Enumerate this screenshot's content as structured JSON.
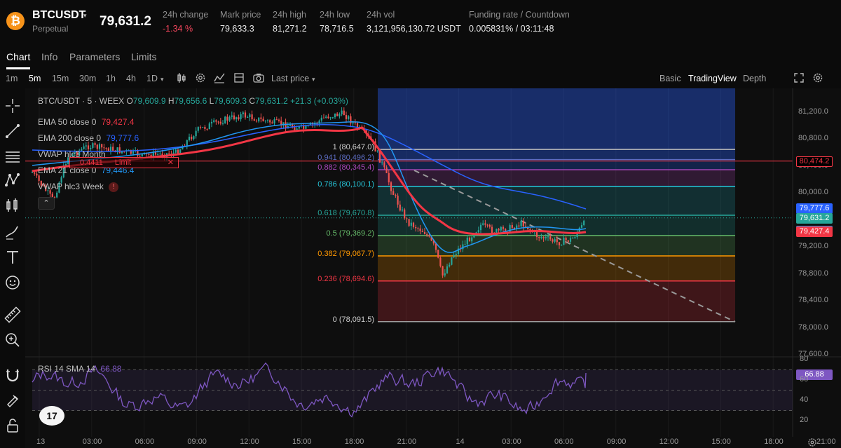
{
  "header": {
    "logo_glyph": "₿",
    "symbol": "BTCUSDT",
    "caret": "▾",
    "contract_type": "Perpetual",
    "last_price": "79,631.2",
    "stats": [
      {
        "label": "24h change",
        "value": "-1.34 %",
        "negative": true
      },
      {
        "label": "Mark price",
        "value": "79,633.3"
      },
      {
        "label": "24h high",
        "value": "81,271.2"
      },
      {
        "label": "24h low",
        "value": "78,716.5"
      },
      {
        "label": "24h vol",
        "value": "3,121,956,130.72 USDT"
      },
      {
        "label": "Funding rate / Countdown",
        "value": "0.005831% / 03:11:48"
      }
    ]
  },
  "tabs": [
    "Chart",
    "Info",
    "Parameters",
    "Limits"
  ],
  "toolbar": {
    "intervals": [
      "1m",
      "5m",
      "15m",
      "30m",
      "1h",
      "4h",
      "1D"
    ],
    "active_interval": "5m",
    "interval_dropdown": "▾",
    "price_source": "Last price",
    "price_source_caret": "▾",
    "views": [
      "Basic",
      "TradingView",
      "Depth"
    ],
    "active_view": "TradingView"
  },
  "chart": {
    "ohlc": {
      "title": "BTC/USDT · 5 · WEEX",
      "o_label": "O",
      "o_value": "79,609.9",
      "h_label": "H",
      "h_value": "79,656.6",
      "l_label": "L",
      "l_value": "79,609.3",
      "c_label": "C",
      "c_value": "79,631.2",
      "change": "+21.3 (+0.03%)"
    },
    "indicators": [
      {
        "label": "EMA 50 close 0",
        "value": "79,427.4",
        "color": "#f23645"
      },
      {
        "label": "EMA 200 close 0",
        "value": "79,777.6",
        "color": "#2962ff"
      },
      {
        "label": "VWAP hlc3 Month",
        "value": "",
        "color": "#bdbdbd"
      },
      {
        "label": "EMA 21 close 0",
        "value": "79,446.4",
        "color": "#2196f3"
      },
      {
        "label": "VWAP hlc3 Week",
        "value": "",
        "color": "#bdbdbd"
      }
    ],
    "warning_glyph": "!",
    "collapse_glyph": "⌃",
    "limit_order": {
      "qty": "0.4411",
      "label": "Limit",
      "close": "✕"
    },
    "fib_levels": [
      {
        "label": "1 (80,647.0)",
        "price": 80647.0,
        "color": "#bdbdbd"
      },
      {
        "label": "0.941 (80,496.2)",
        "price": 80496.2,
        "color": "#5c6bc0"
      },
      {
        "label": "0.882 (80,345.4)",
        "price": 80345.4,
        "color": "#ab47bc"
      },
      {
        "label": "0.786 (80,100.1)",
        "price": 80100.1,
        "color": "#26c6da"
      },
      {
        "label": "0.618 (79,670.8)",
        "price": 79670.8,
        "color": "#26a69a"
      },
      {
        "label": "0.5 (79,369.2)",
        "price": 79369.2,
        "color": "#66bb6a"
      },
      {
        "label": "0.382 (79,067.7)",
        "price": 79067.7,
        "color": "#ff9800"
      },
      {
        "label": "0.236 (78,694.6)",
        "price": 78694.6,
        "color": "#f23645"
      },
      {
        "label": "0 (78,091.5)",
        "price": 78091.5,
        "color": "#9e9e9e"
      }
    ],
    "price_axis": [
      "81,200.0",
      "80,800.0",
      "80,400.0",
      "80,000.0",
      "79,600.0",
      "79,200.0",
      "78,800.0",
      "78,400.0",
      "78,000.0",
      "77,600.0"
    ],
    "price_tags": [
      {
        "text": "80,474.2",
        "color": "#000000",
        "border": "#f23645",
        "price": 80474.2
      },
      {
        "text": "79,777.6",
        "color": "#2962ff",
        "price": 79777.6
      },
      {
        "text": "79,631.2",
        "color": "#26a69a",
        "price": 79631.2
      },
      {
        "text": "79,446.4",
        "color": "#2196f3",
        "price": 79446.4
      },
      {
        "text": "79,427.4",
        "color": "#f23645",
        "price": 79427.4
      }
    ],
    "time_axis": [
      "13",
      "03:00",
      "06:00",
      "09:00",
      "12:00",
      "15:00",
      "18:00",
      "21:00",
      "14",
      "03:00",
      "06:00",
      "09:00",
      "12:00",
      "15:00",
      "18:00",
      "21:00"
    ],
    "rsi": {
      "label": "RSI 14 SMA 14",
      "value": "66.88",
      "axis": [
        "80",
        "60",
        "40",
        "20"
      ]
    },
    "tv_logo": "17"
  }
}
